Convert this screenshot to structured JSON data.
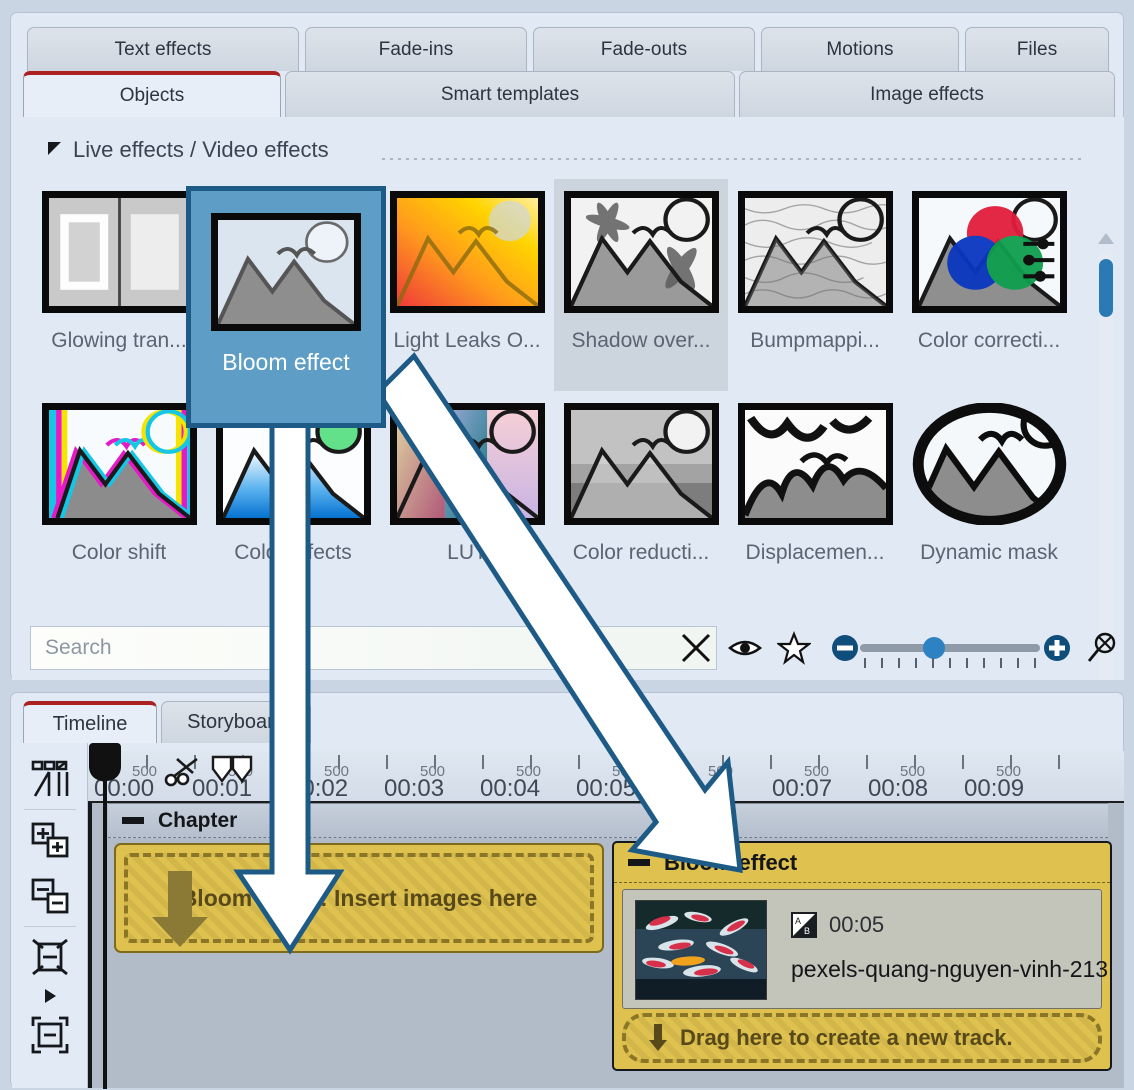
{
  "tabs_top": [
    {
      "label": "Text effects"
    },
    {
      "label": "Fade-ins"
    },
    {
      "label": "Fade-outs"
    },
    {
      "label": "Motions"
    },
    {
      "label": "Files"
    }
  ],
  "tabs_second": [
    {
      "label": "Objects",
      "active": true
    },
    {
      "label": "Smart templates",
      "active": false
    },
    {
      "label": "Image effects",
      "active": false
    }
  ],
  "effects_panel": {
    "section_title": "Live effects / Video effects",
    "row1": [
      {
        "label": "Glowing tran...",
        "icon": "glowing-transition-thumb"
      },
      {
        "label": "Bloom effect",
        "icon": "bloom-effect-thumb"
      },
      {
        "label": "Light Leaks O...",
        "icon": "light-leaks-thumb"
      },
      {
        "label": "Shadow over...",
        "icon": "shadow-overlay-thumb"
      },
      {
        "label": "Bumpmappi...",
        "icon": "bumpmapping-thumb"
      },
      {
        "label": "Color correcti...",
        "icon": "color-correction-thumb"
      }
    ],
    "row2": [
      {
        "label": "Color shift",
        "icon": "color-shift-thumb"
      },
      {
        "label": "Color effects",
        "icon": "color-effects-thumb"
      },
      {
        "label": "LUT",
        "icon": "lut-thumb"
      },
      {
        "label": "Color reducti...",
        "icon": "color-reduction-thumb"
      },
      {
        "label": "Displacemen...",
        "icon": "displacement-thumb"
      },
      {
        "label": "Dynamic mask",
        "icon": "dynamic-mask-thumb"
      }
    ],
    "selected_effect": "Shadow over...",
    "search_placeholder": "Search",
    "search_value": "",
    "toolbar_icons": [
      "clear-search-icon",
      "preview-eye-icon",
      "favorite-star-icon",
      "zoom-out-icon",
      "size-slider",
      "zoom-in-icon",
      "reset-zoom-icon"
    ],
    "slider_value": 35
  },
  "highlight": {
    "label": "Bloom effect",
    "border_color": "#1d5b86",
    "fill_color": "#5e9ec6"
  },
  "timeline": {
    "tabs": [
      {
        "label": "Timeline",
        "active": true
      },
      {
        "label": "Storyboard",
        "active": false
      }
    ],
    "side_icons": [
      "object-mode-icon",
      "add-track-icon",
      "remove-track-icon",
      "shrink-track-height-icon",
      "expand-caret-icon",
      "expand-track-height-icon"
    ],
    "ruler": {
      "second_labels": [
        "00:00",
        "00:01",
        "00:02",
        "00:03",
        "00:04",
        "00:05",
        "00:07",
        "00:08",
        "00:09"
      ],
      "sub_label": "500"
    },
    "chapter_label": "Chapter",
    "dropzone_text": "Bloom effect: Insert images here",
    "effect_track": {
      "title": "Bloom effect",
      "clip_duration": "00:05",
      "clip_name": "pexels-quang-nguyen-vinh-213",
      "new_track_text": "Drag here to create a new track.",
      "badge_icon": "ab-transition-icon"
    }
  },
  "annotations": {
    "arrow_color": "#1d5b86",
    "arrow_fill": "#ffffff",
    "arrows": [
      {
        "name": "drag-arrow-to-dropzone"
      },
      {
        "name": "drag-arrow-to-effect-track"
      }
    ]
  },
  "colors": {
    "panel_bg": "#e1e9f4",
    "accent_red": "#ab2020",
    "accent_blue": "#2b7ab5",
    "track_yellow": "#dfc14f"
  }
}
